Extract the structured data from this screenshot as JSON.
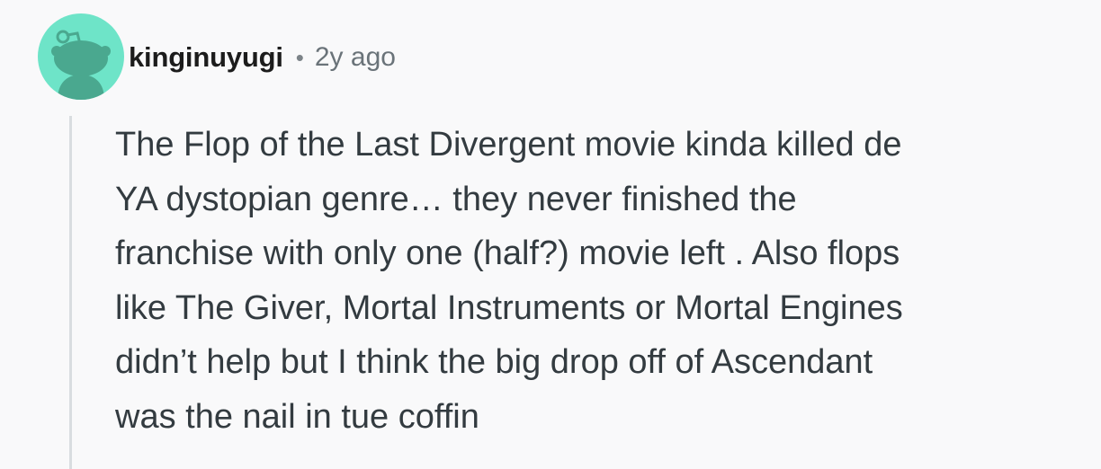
{
  "comment": {
    "author": "kinginuyugi",
    "separator": "•",
    "age": "2y ago",
    "body_lines": [
      "The Flop of the Last Divergent movie kinda killed de",
      "YA dystopian genre… they never finished the",
      "franchise with only one (half?) movie left . Also flops",
      "like The Giver, Mortal Instruments or Mortal Engines",
      "didn’t help but I think the big drop off of Ascendant",
      "was the nail in tue coffin"
    ]
  },
  "avatar": {
    "icon": "reddit-snoo-avatar-icon",
    "background_color": "#6ee4c8",
    "figure_color": "#4aa88f"
  },
  "colors": {
    "page_background": "#f9f9fa",
    "thread_line": "#d9dde0",
    "username_text": "#1c1c1c",
    "meta_text": "#6a7379",
    "body_text": "#333b40"
  }
}
